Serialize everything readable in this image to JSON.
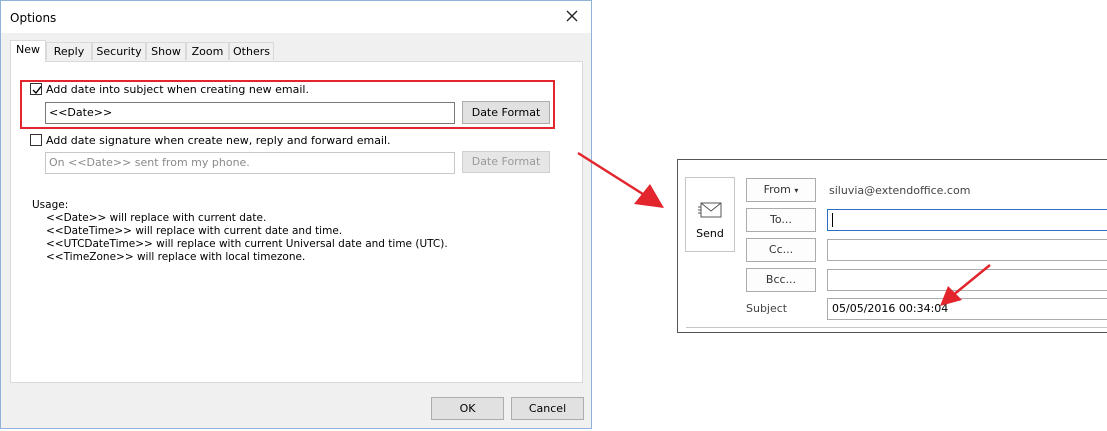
{
  "dialog": {
    "title": "Options",
    "tabs": [
      "New",
      "Reply",
      "Security",
      "Show",
      "Zoom",
      "Others"
    ],
    "active_tab": "New",
    "option1": {
      "checked": true,
      "label": "Add date into subject when creating new email.",
      "value": "<<Date>>",
      "button": "Date Format"
    },
    "option2": {
      "checked": false,
      "label": "Add date signature when create new, reply and forward email.",
      "placeholder": "On <<Date>> sent from my phone.",
      "button": "Date Format"
    },
    "usage": {
      "heading": "Usage:",
      "lines": [
        "<<Date>> will replace with current date.",
        "<<DateTime>> will replace with current date and time.",
        "<<UTCDateTime>> will replace with current Universal date and time (UTC).",
        "<<TimeZone>> will replace with local timezone."
      ]
    },
    "ok": "OK",
    "cancel": "Cancel"
  },
  "compose": {
    "send": "Send",
    "from_button": "From",
    "from_address": "siluvia@extendoffice.com",
    "to_button": "To...",
    "cc_button": "Cc...",
    "bcc_button": "Bcc...",
    "subject_label": "Subject",
    "subject_value": "05/05/2016 00:34:04"
  },
  "colors": {
    "highlight": "#e3262e",
    "dialog_bg": "#f0f0f0",
    "window_border": "#8fb3d9"
  }
}
